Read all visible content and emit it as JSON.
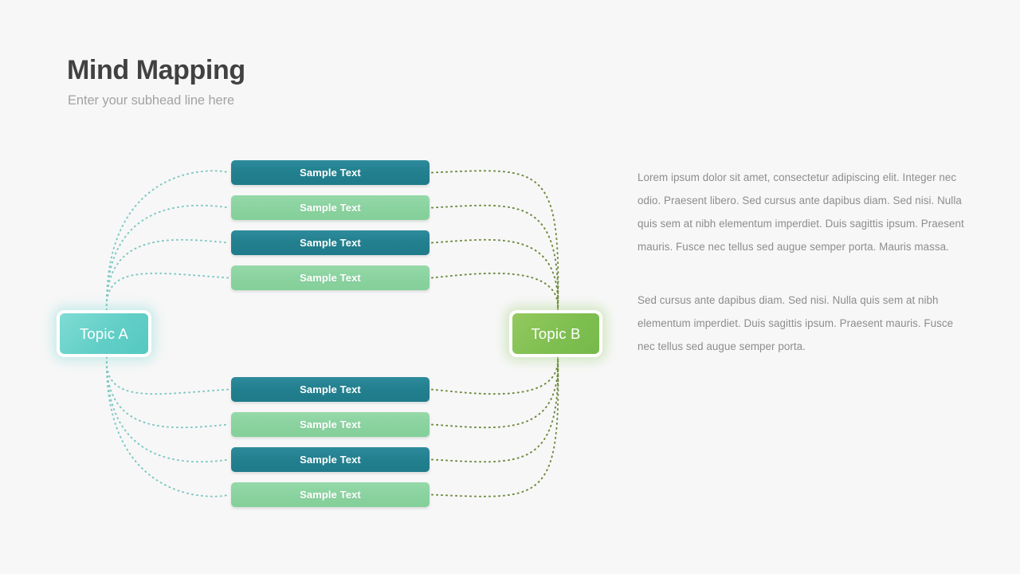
{
  "header": {
    "title": "Mind Mapping",
    "subtitle": "Enter your subhead line here"
  },
  "diagram": {
    "hubs": [
      {
        "id": "topic-a",
        "label": "Topic A",
        "color": "#62cfc7"
      },
      {
        "id": "topic-b",
        "label": "Topic B",
        "color": "#7fbf51"
      }
    ],
    "top_group": [
      {
        "label": "Sample Text",
        "style": "dark",
        "color": "#23808f"
      },
      {
        "label": "Sample Text",
        "style": "light",
        "color": "#8bd3a0"
      },
      {
        "label": "Sample Text",
        "style": "dark",
        "color": "#23808f"
      },
      {
        "label": "Sample Text",
        "style": "light",
        "color": "#8bd3a0"
      }
    ],
    "bottom_group": [
      {
        "label": "Sample Text",
        "style": "dark",
        "color": "#23808f"
      },
      {
        "label": "Sample Text",
        "style": "light",
        "color": "#8bd3a0"
      },
      {
        "label": "Sample Text",
        "style": "dark",
        "color": "#23808f"
      },
      {
        "label": "Sample Text",
        "style": "light",
        "color": "#8bd3a0"
      }
    ],
    "connector_colors": {
      "left": "#7fc9c2",
      "right": "#6f8a3f"
    }
  },
  "body": {
    "paragraph_1": "Lorem ipsum dolor sit amet, consectetur adipiscing elit. Integer nec odio. Praesent libero. Sed cursus ante dapibus diam. Sed nisi. Nulla quis sem at nibh elementum imperdiet. Duis sagittis ipsum. Praesent mauris. Fusce nec tellus sed augue semper porta. Mauris massa.",
    "paragraph_2": "Sed cursus ante dapibus diam. Sed nisi. Nulla quis sem at nibh elementum imperdiet. Duis sagittis ipsum. Praesent mauris. Fusce nec tellus sed augue semper porta."
  },
  "theme": {
    "background": "#f7f7f7",
    "title_color": "#414141",
    "subtitle_color": "#a3a3a3",
    "body_text_color": "#8d8d8d"
  }
}
